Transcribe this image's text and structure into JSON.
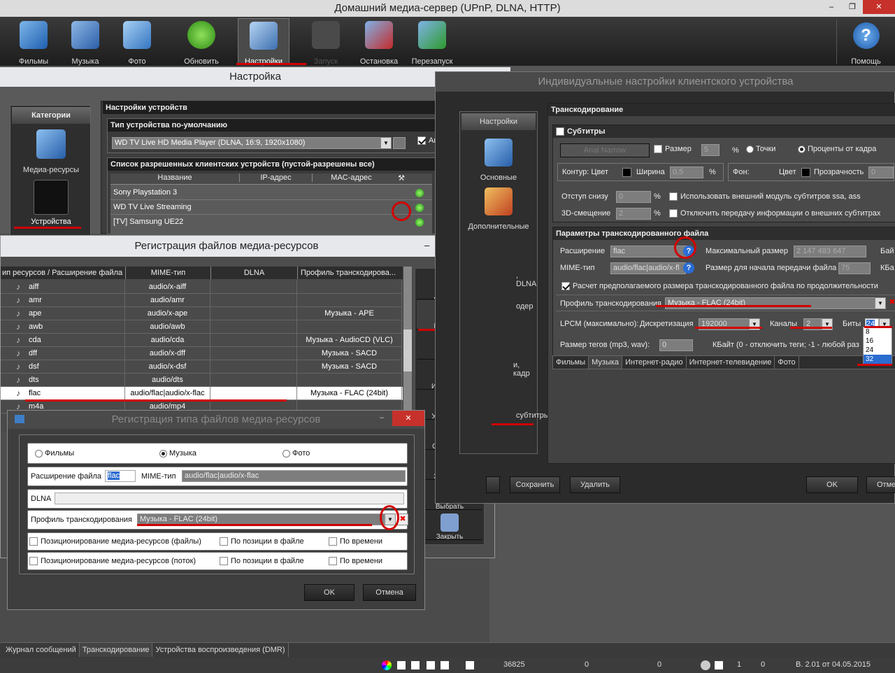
{
  "app": {
    "title": "Домашний медиа-сервер (UPnP, DLNA, HTTP)",
    "min": "–",
    "max": "❐",
    "close": "✕"
  },
  "toolbar": {
    "films": "Фильмы",
    "music": "Музыка",
    "photo": "Фото",
    "refresh": "Обновить",
    "settings": "Настройки",
    "run": "Запуск",
    "stop": "Остановка",
    "restart": "Перезапуск",
    "help": "Помощь"
  },
  "settings": {
    "title": "Настройка",
    "categories_title": "Категории",
    "cat_media": "Медиа-ресурсы",
    "cat_devices": "Устройства",
    "devices_header": "Настройки устройств",
    "default_type_label": "Тип устройства по-умолчанию",
    "default_type_value": "WD TV Live HD Media Player (DLNA, 16:9, 1920x1080)",
    "auto_label": "Ав",
    "allowed_label": "Список разрешенных клиентских устройств (пустой-разрешены все)",
    "cols": [
      "Название",
      "IP-адрес",
      "MAC-адрес"
    ],
    "devices": [
      "Sony Playstation 3",
      "WD TV Live Streaming",
      "[TV] Samsung UE22"
    ]
  },
  "reg": {
    "title": "Регистрация файлов медиа-ресурсов",
    "min": "–",
    "max": "☐",
    "close": "✕",
    "cols": [
      "ип ресурсов / Расширение файла",
      "MIME-тип",
      "DLNA",
      "Профиль транскодирова..."
    ],
    "rows": [
      {
        "ext": "aiff",
        "mime": "audio/x-aiff",
        "dlna": "",
        "profile": ""
      },
      {
        "ext": "amr",
        "mime": "audio/amr",
        "dlna": "",
        "profile": ""
      },
      {
        "ext": "ape",
        "mime": "audio/x-ape",
        "dlna": "",
        "profile": "Музыка - APE"
      },
      {
        "ext": "awb",
        "mime": "audio/awb",
        "dlna": "",
        "profile": ""
      },
      {
        "ext": "cda",
        "mime": "audio/cda",
        "dlna": "",
        "profile": "Музыка - AudioCD (VLC)"
      },
      {
        "ext": "dff",
        "mime": "audio/x-dff",
        "dlna": "",
        "profile": "Музыка - SACD"
      },
      {
        "ext": "dsf",
        "mime": "audio/x-dsf",
        "dlna": "",
        "profile": "Музыка - SACD"
      },
      {
        "ext": "dts",
        "mime": "audio/dts",
        "dlna": "",
        "profile": ""
      },
      {
        "ext": "flac",
        "mime": "audio/flac|audio/x-flac",
        "dlna": "",
        "profile": "Музыка - FLAC (24bit)"
      },
      {
        "ext": "m4a",
        "mime": "audio/mp4",
        "dlna": "",
        "profile": ""
      }
    ],
    "side": [
      "Добавить",
      "Изменить",
      "Удалить",
      "Из реестра",
      "Умолчание",
      "Сохранить",
      "Загрузить",
      "Выбрать",
      "Закрыть"
    ]
  },
  "type_dlg": {
    "title": "Регистрация типа файлов медиа-ресурсов",
    "close": "✕",
    "films": "Фильмы",
    "music": "Музыка",
    "photo": "Фото",
    "ext_label": "Расширение файла",
    "ext_value": "flac",
    "mime_label": "MIME-тип",
    "mime_value": "audio/flac|audio/x-flac",
    "dlna_label": "DLNA",
    "profile_label": "Профиль транскодирования",
    "profile_value": "Музыка - FLAC (24bit)",
    "pos_files": "Позиционирование медиа-ресурсов (файлы)",
    "pos_stream": "Позиционирование медиа-ресурсов (поток)",
    "by_pos": "По позиции в файле",
    "by_time": "По времени",
    "ok": "OK",
    "cancel": "Отмена"
  },
  "ind": {
    "title": "Индивидуальные настройки клиентского устройства",
    "side_title": "Настройки",
    "side": [
      "Основные",
      "Дополнительные",
      ", DLNA",
      "одер",
      "и, кадр",
      "субтитры"
    ],
    "transcoding": "Транскодирование",
    "subtitles": "Субтитры",
    "font_btn": "Arial Narrow",
    "size_label": "Размер",
    "size_value": "5",
    "pct": "%",
    "points": "Точки",
    "pct_frame": "Проценты от кадра",
    "contour_label": "Контур: Цвет",
    "width_label": "Ширина",
    "width_value": "0,5",
    "bg_label": "Фон:",
    "color_label": "Цвет",
    "transp_label": "Прозрачность",
    "transp_value": "0",
    "indent_label": "Отступ снизу",
    "indent_value": "0",
    "ext_module": "Использовать внешний модуль субтитров ssa, ass",
    "shift3d_label": "3D-смещение",
    "shift3d_value": "2",
    "no_ext_sub": "Отключить передачу информации о внешних субтитрах",
    "params": "Параметры транскодированного файла",
    "ext_label": "Расширение",
    "ext_value": "flac",
    "maxsize_label": "Максимальный размер",
    "maxsize_value": "2 147 483 647",
    "bytes": "Бай",
    "mime_label": "MIME-тип",
    "mime_value": "audio/flac|audio/x-fl",
    "start_label": "Размер для начала передачи файла",
    "start_value": "75",
    "kb": "КБа",
    "calc": "Расчет предполагаемого размера транскодированного файла по продолжительности",
    "profile_label": "Профиль транскодирования",
    "profile_value": "Музыка - FLAC (24bit)",
    "lpcm": "LPCM (максимально):",
    "rate_label": "Дискретизация",
    "rate_value": "192000",
    "channels_label": "Каналы",
    "channels_value": "2",
    "bits_label": "Биты",
    "bits_value": "24",
    "bits_options": [
      "8",
      "16",
      "24",
      "32"
    ],
    "tags_label": "Размер тегов (mp3, wav):",
    "tags_value": "0",
    "tags_hint": "КБайт (0 - отключить теги; -1 - любой раз",
    "tabs": [
      "Фильмы",
      "Музыка",
      "Интернет-радио",
      "Интернет-телевидение",
      "Фото"
    ],
    "save": "Сохранить",
    "delete": "Удалить",
    "ok": "OK",
    "cancel": "Отме"
  },
  "bottom_tabs": [
    "Журнал сообщений",
    "Транскодирование",
    "Устройства воспроизведения (DMR)"
  ],
  "status": {
    "n1": "36825",
    "n2": "0",
    "n3": "0",
    "n4": "1",
    "n5": "0",
    "version": "В. 2.01 от 04.05.2015"
  }
}
